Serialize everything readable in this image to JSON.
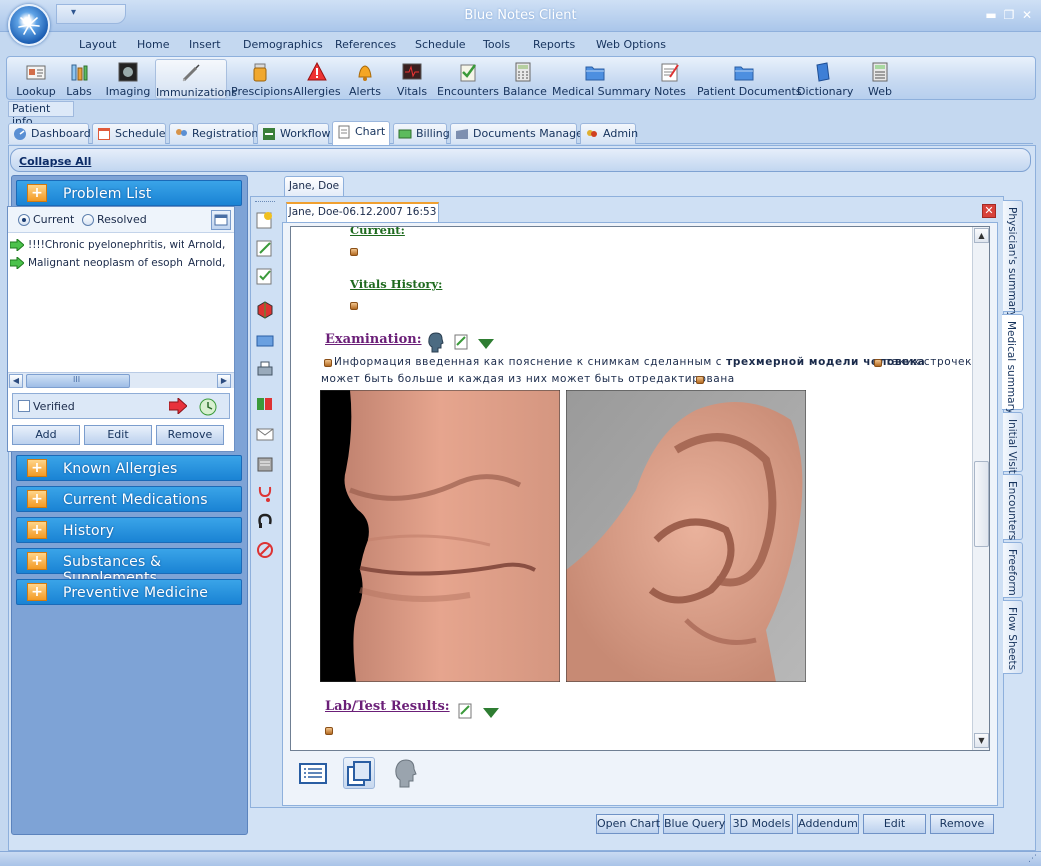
{
  "window": {
    "title": "Blue Notes Client"
  },
  "menu": [
    "Layout",
    "Home",
    "Insert",
    "Demographics",
    "References",
    "Schedule",
    "Tools",
    "Reports",
    "Web Options"
  ],
  "ribbon": [
    {
      "label": "Lookup",
      "icon": "lookup-icon"
    },
    {
      "label": "Labs",
      "icon": "labs-icon"
    },
    {
      "label": "Imaging",
      "icon": "imaging-icon"
    },
    {
      "label": "Immunizations",
      "icon": "syringe-icon"
    },
    {
      "label": "Prescipions",
      "icon": "pill-bottle-icon"
    },
    {
      "label": "Allergies",
      "icon": "warning-icon"
    },
    {
      "label": "Alerts",
      "icon": "bell-icon"
    },
    {
      "label": "Vitals",
      "icon": "monitor-icon"
    },
    {
      "label": "Encounters",
      "icon": "clipboard-icon"
    },
    {
      "label": "Balance",
      "icon": "calculator-icon"
    },
    {
      "label": "Medical Summary",
      "icon": "folder-icon"
    },
    {
      "label": "Notes",
      "icon": "notes-icon"
    },
    {
      "label": "Patient Documents",
      "icon": "folder-icon"
    },
    {
      "label": "Dictionary",
      "icon": "book-icon"
    },
    {
      "label": "Web",
      "icon": "web-icon"
    }
  ],
  "patient_info_label": "Patient info",
  "module_tabs": [
    "Dashboard",
    "Schedule",
    "Registration",
    "Workflow",
    "Chart",
    "Billing",
    "Documents Manager",
    "Admin"
  ],
  "left": {
    "collapse_all": "Collapse All",
    "problem_list": {
      "title": "Problem List",
      "radio_current": "Current",
      "radio_resolved": "Resolved",
      "rows": [
        {
          "text": "!!!!Chronic pyelonephritis, wit...",
          "author": "Arnold,"
        },
        {
          "text": "Malignant neoplasm of esoph...",
          "author": "Arnold,"
        }
      ],
      "scroll_thumb": "III",
      "verified": "Verified",
      "add": "Add",
      "edit": "Edit",
      "remove": "Remove"
    },
    "sections": [
      "Known Allergies",
      "Current Medications",
      "History",
      "Substances & Supplements",
      "Preventive Medicine"
    ]
  },
  "right": {
    "patient_tab": "Jane, Doe",
    "doc_tab": "Jane, Doe-06.12.2007 16:53",
    "doc": {
      "current": "Current:",
      "vitals_history": "Vitals History:",
      "examination": "Examination:",
      "ex_line1_a": "Информация введенная как пояснение к снимкам сделанным с",
      "ex_line1_b": "трехмерной модели человека",
      "ex_line1_c": "таких строчек",
      "ex_line2": "может быть больше и каждая из них может быть отредактирована",
      "lab_results": "Lab/Test Results:"
    },
    "side_tabs": [
      "Physician's summary",
      "Medical summary",
      "Initial Visit",
      "Encounters",
      "Freeform",
      "Flow Sheets"
    ],
    "bottom_buttons": [
      "Open Chart",
      "Blue Query",
      "3D Models",
      "Addendum",
      "Edit",
      "Remove"
    ]
  },
  "colors": {
    "accent": "#1a83d4",
    "skin": "#e0a088",
    "bg": "#c4d8f0"
  }
}
